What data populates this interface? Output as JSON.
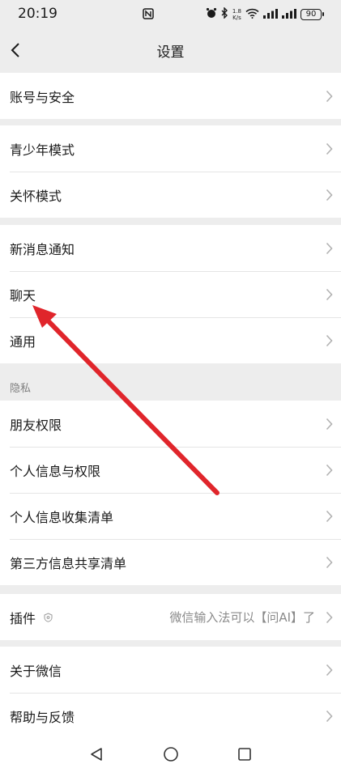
{
  "status_bar": {
    "time": "20:19",
    "net_speed_value": "1.8",
    "net_speed_unit": "K/s",
    "battery": "90"
  },
  "header": {
    "title": "设置"
  },
  "groups": {
    "account": {
      "items": [
        {
          "label": "账号与安全"
        }
      ]
    },
    "modes": {
      "items": [
        {
          "label": "青少年模式"
        },
        {
          "label": "关怀模式"
        }
      ]
    },
    "general": {
      "items": [
        {
          "label": "新消息通知"
        },
        {
          "label": "聊天"
        },
        {
          "label": "通用"
        }
      ]
    },
    "privacy": {
      "section_title": "隐私",
      "items": [
        {
          "label": "朋友权限"
        },
        {
          "label": "个人信息与权限"
        },
        {
          "label": "个人信息收集清单"
        },
        {
          "label": "第三方信息共享清单"
        }
      ]
    },
    "plugins": {
      "items": [
        {
          "label": "插件",
          "value": "微信输入法可以【问AI】了"
        }
      ]
    },
    "about": {
      "items": [
        {
          "label": "关于微信"
        },
        {
          "label": "帮助与反馈"
        }
      ]
    }
  },
  "colors": {
    "background": "#ededed",
    "row_background": "#ffffff",
    "annotation_arrow": "#e0252b"
  }
}
